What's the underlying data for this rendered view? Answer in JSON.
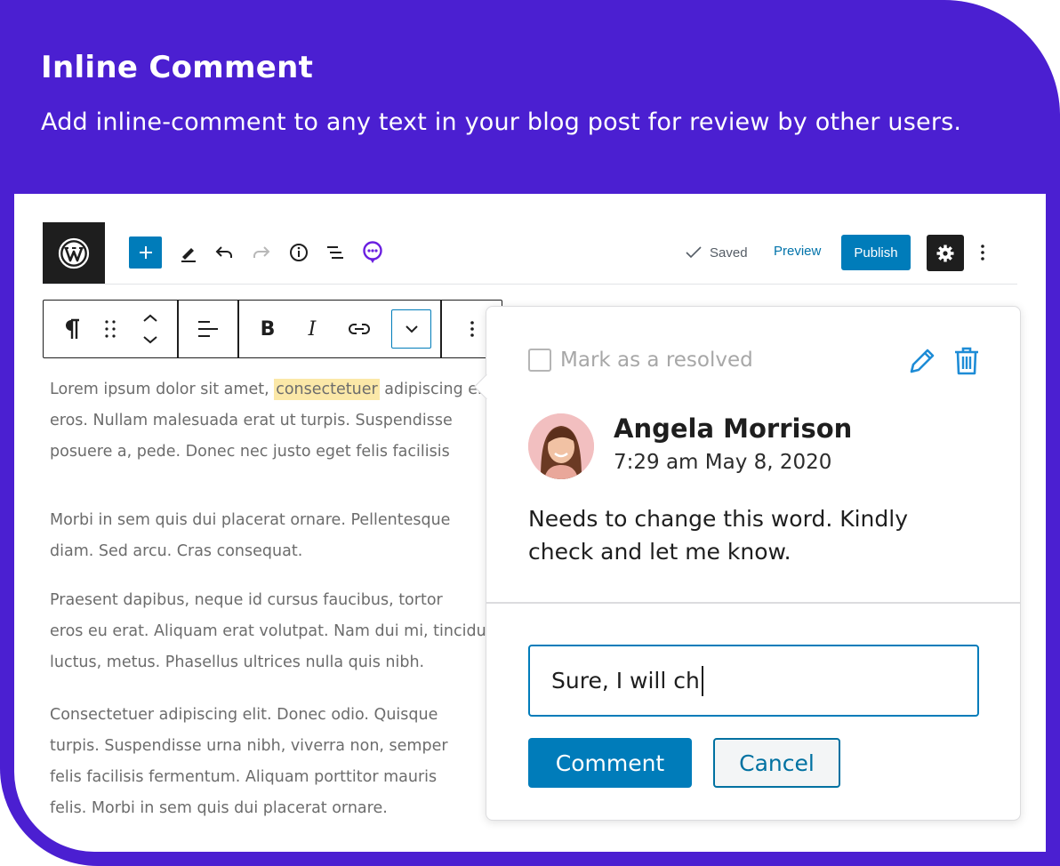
{
  "promo": {
    "title": "Inline Comment",
    "subtitle": "Add inline-comment to any text in your blog post for review by other users."
  },
  "colors": {
    "brand_purple": "#4b1fd1",
    "wp_blue": "#007cba",
    "highlight": "#fbe8a8",
    "dark": "#1e1e1e"
  },
  "topbar": {
    "logo_icon": "wordpress-logo-icon",
    "add_icon": "plus-icon",
    "tools_icon": "pencil-icon",
    "undo_icon": "undo-icon",
    "redo_icon": "redo-icon",
    "info_icon": "info-icon",
    "outline_icon": "list-icon",
    "comments_icon": "comment-bubble-icon",
    "saved_label": "Saved",
    "preview_label": "Preview",
    "publish_label": "Publish",
    "settings_icon": "gear-icon",
    "more_icon": "vertical-ellipsis-icon"
  },
  "block_toolbar": {
    "paragraph_icon": "pilcrow-icon",
    "drag_icon": "drag-handle-icon",
    "move_icon": "chevron-up-down-icon",
    "align_icon": "align-left-icon",
    "bold_label": "B",
    "italic_label": "I",
    "link_icon": "link-icon",
    "more_rich_icon": "chevron-down-icon",
    "options_icon": "vertical-ellipsis-icon"
  },
  "content": {
    "p1": {
      "before": "Lorem ipsum dolor sit amet, ",
      "highlight": "consectetuer",
      "after": " adipiscing elit.",
      "line2": "eros. Nullam malesuada erat ut turpis. Suspendisse",
      "line3": "posuere a, pede. Donec nec justo eget felis facilisis"
    },
    "p2": {
      "line1": "Morbi in sem quis dui placerat ornare. Pellentesque",
      "line2": "diam. Sed arcu. Cras consequat."
    },
    "p3": {
      "line1": "Praesent dapibus, neque id cursus faucibus, tortor",
      "line2": "eros eu erat. Aliquam erat volutpat. Nam dui mi, tincidunt",
      "line3": "luctus, metus. Phasellus ultrices nulla quis nibh."
    },
    "p4": {
      "line1": "Consectetuer adipiscing elit. Donec odio. Quisque",
      "line2": "turpis. Suspendisse urna nibh, viverra non, semper",
      "line3": "felis facilisis fermentum. Aliquam porttitor mauris",
      "line4": "felis. Morbi in sem quis dui placerat ornare."
    }
  },
  "comment": {
    "resolve_label": "Mark as a resolved",
    "edit_icon": "pencil-icon",
    "delete_icon": "trash-icon",
    "avatar_icon": "user-avatar-icon",
    "author": "Angela Morrison",
    "time": "7:29 am May 8, 2020",
    "text": "Needs to change this word. Kindly check and let me know.",
    "reply_value": "Sure, I will ch",
    "submit_label": "Comment",
    "cancel_label": "Cancel"
  }
}
